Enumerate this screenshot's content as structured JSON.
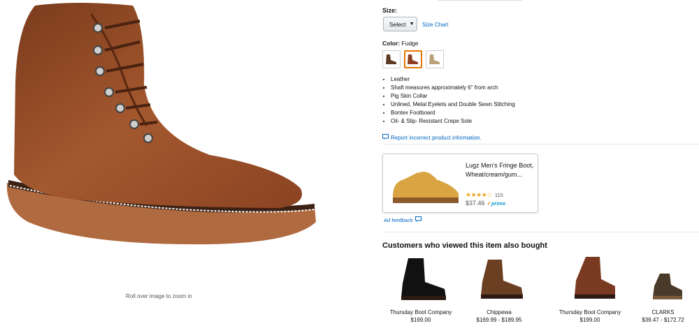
{
  "gallery": {
    "zoom_hint": "Roll over image to zoom in"
  },
  "size": {
    "label": "Size:",
    "select_value": "Select",
    "size_chart": "Size Chart"
  },
  "color": {
    "label": "Color:",
    "value": "Fudge",
    "swatches": [
      "dark-brown",
      "fudge",
      "wheat"
    ]
  },
  "bullets": [
    "Leather",
    "Shaft measures approximately 6\" from arch",
    "Pig Skin Collar",
    "Unlined, Metal Eyelets and Double Sewn Stitching",
    "Bontex Footboard",
    "Oil- & Slip- Resistant Crepe Sole"
  ],
  "report_link": "Report incorrect product information.",
  "ad": {
    "title": "Lugz Men's Fringe Boot, Wheat/cream/gum...",
    "stars": "★★★★☆",
    "rating_count": "115",
    "price": "$37.46",
    "prime_label": "prime",
    "feedback": "Ad feedback"
  },
  "also_bought": {
    "heading": "Customers who viewed this item also bought",
    "items": [
      {
        "brand": "Thursday Boot Company",
        "price": "$199.00"
      },
      {
        "brand": "Chippewa",
        "price": "$169.99 - $189.95"
      },
      {
        "brand": "Thursday Boot Company",
        "price": "$199.00"
      },
      {
        "brand": "CLARKS",
        "price": "$39.47 - $172.72"
      }
    ]
  },
  "colors": {
    "link": "#0066c0",
    "selected_border": "#e77600",
    "star": "#f0a41b",
    "prime": "#1399d1"
  }
}
